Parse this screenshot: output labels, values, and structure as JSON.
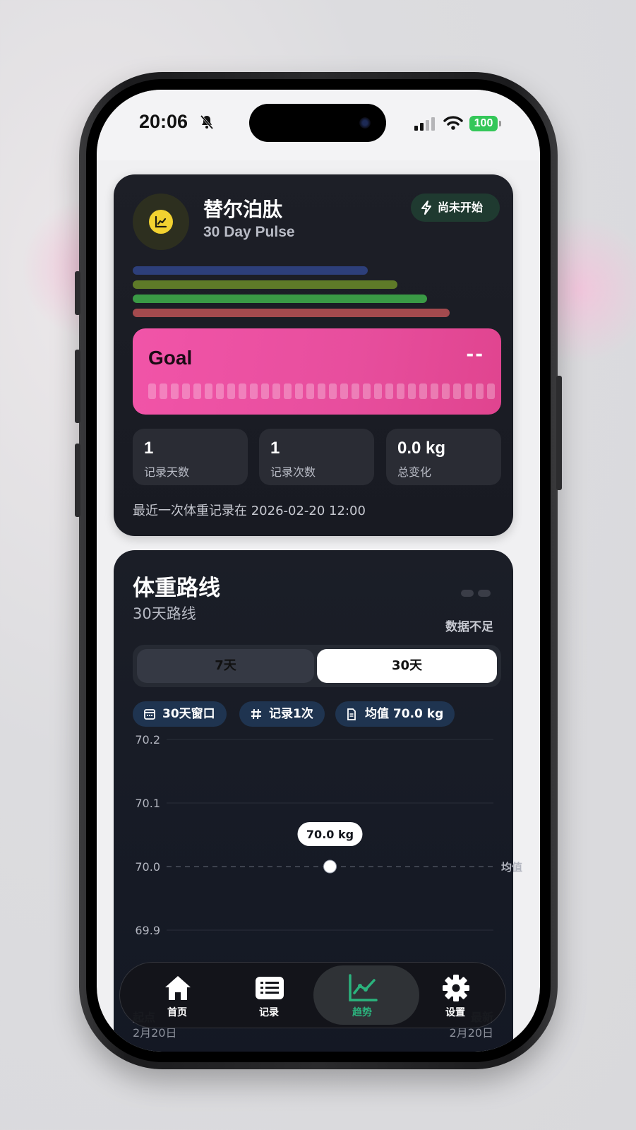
{
  "status_bar": {
    "time": "20:06",
    "battery": "100"
  },
  "peptide_card": {
    "title": "替尔泊肽",
    "subtitle": "30 Day Pulse",
    "status": "尚未开始",
    "goal": {
      "label": "Goal",
      "value": "--"
    },
    "stats": [
      {
        "value": "1",
        "label": "记录天数"
      },
      {
        "value": "1",
        "label": "记录次数"
      },
      {
        "value": "0.0 kg",
        "label": "总变化"
      }
    ],
    "last_record": "最近一次体重记录在 2026-02-20 12:00"
  },
  "weight_card": {
    "title": "体重路线",
    "subtitle": "30天路线",
    "data_status": "数据不足",
    "range_options": [
      "7天",
      "30天"
    ],
    "selected_range": "30天",
    "chips": [
      {
        "icon": "calendar-icon",
        "label": "30天窗口"
      },
      {
        "icon": "hash-icon",
        "label": "记录1次"
      },
      {
        "icon": "document-icon",
        "label": "均值 70.0 kg"
      }
    ],
    "axis_start": {
      "label": "起点",
      "date": "2月20日"
    },
    "axis_end": {
      "label": "最新",
      "date": "2月20日"
    }
  },
  "chart_data": {
    "type": "line",
    "y_ticks": [
      "70.2",
      "70.1",
      "70.0",
      "69.9"
    ],
    "ylim": [
      69.9,
      70.2
    ],
    "points": [
      {
        "x": "2月20日",
        "y": 70.0
      }
    ],
    "point_label": "70.0 kg",
    "mean": 70.0,
    "mean_label": "均值",
    "grid": true
  },
  "tabbar": {
    "items": [
      {
        "label": "首页",
        "icon": "home-icon"
      },
      {
        "label": "记录",
        "icon": "list-icon"
      },
      {
        "label": "趋势",
        "icon": "trend-icon"
      },
      {
        "label": "设置",
        "icon": "gear-icon"
      }
    ],
    "active": "趋势"
  },
  "colors": {
    "accent_green": "#2bb37d",
    "goal_pink": "#ec4e9f",
    "bar_blue": "#2d3f7a",
    "bar_olive": "#5e7a28",
    "bar_green": "#3a9a45",
    "bar_red": "#a34a4e"
  }
}
